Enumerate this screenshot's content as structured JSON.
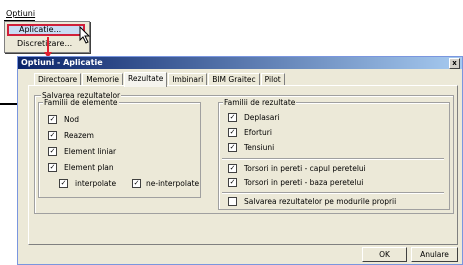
{
  "menu": {
    "title": "Optiuni",
    "items": [
      {
        "label": "Aplicatie..."
      },
      {
        "label": "Discretizare..."
      }
    ]
  },
  "dialog": {
    "title": "Optiuni - Aplicatie",
    "close_label": "x",
    "tabs": [
      {
        "label": "Directoare"
      },
      {
        "label": "Memorie"
      },
      {
        "label": "Rezultate"
      },
      {
        "label": "Imbinari"
      },
      {
        "label": "BIM Graitec"
      },
      {
        "label": "Pilot"
      }
    ],
    "active_tab": "Rezultate",
    "group_title": "Salvarea rezultatelor",
    "elements_group": {
      "title": "Familii de elemente",
      "items": [
        {
          "label": "Nod",
          "checked": true
        },
        {
          "label": "Reazem",
          "checked": true
        },
        {
          "label": "Element liniar",
          "checked": true
        },
        {
          "label": "Element plan",
          "checked": true
        }
      ],
      "sub_items": [
        {
          "label": "interpolate",
          "checked": true
        },
        {
          "label": "ne-interpolate",
          "checked": true
        }
      ]
    },
    "results_group": {
      "title": "Familii de rezultate",
      "items": [
        {
          "label": "Deplasari",
          "checked": true
        },
        {
          "label": "Eforturi",
          "checked": true
        },
        {
          "label": "Tensiuni",
          "checked": true
        }
      ],
      "torsor_items": [
        {
          "label": "Torsori in pereti - capul peretelui",
          "checked": true
        },
        {
          "label": "Torsori in pereti - baza peretelui",
          "checked": true
        }
      ],
      "own_models": {
        "label": "Salvarea rezultatelor pe modurile proprii",
        "checked": false
      }
    },
    "buttons": {
      "ok": "OK",
      "cancel": "Anulare"
    }
  }
}
